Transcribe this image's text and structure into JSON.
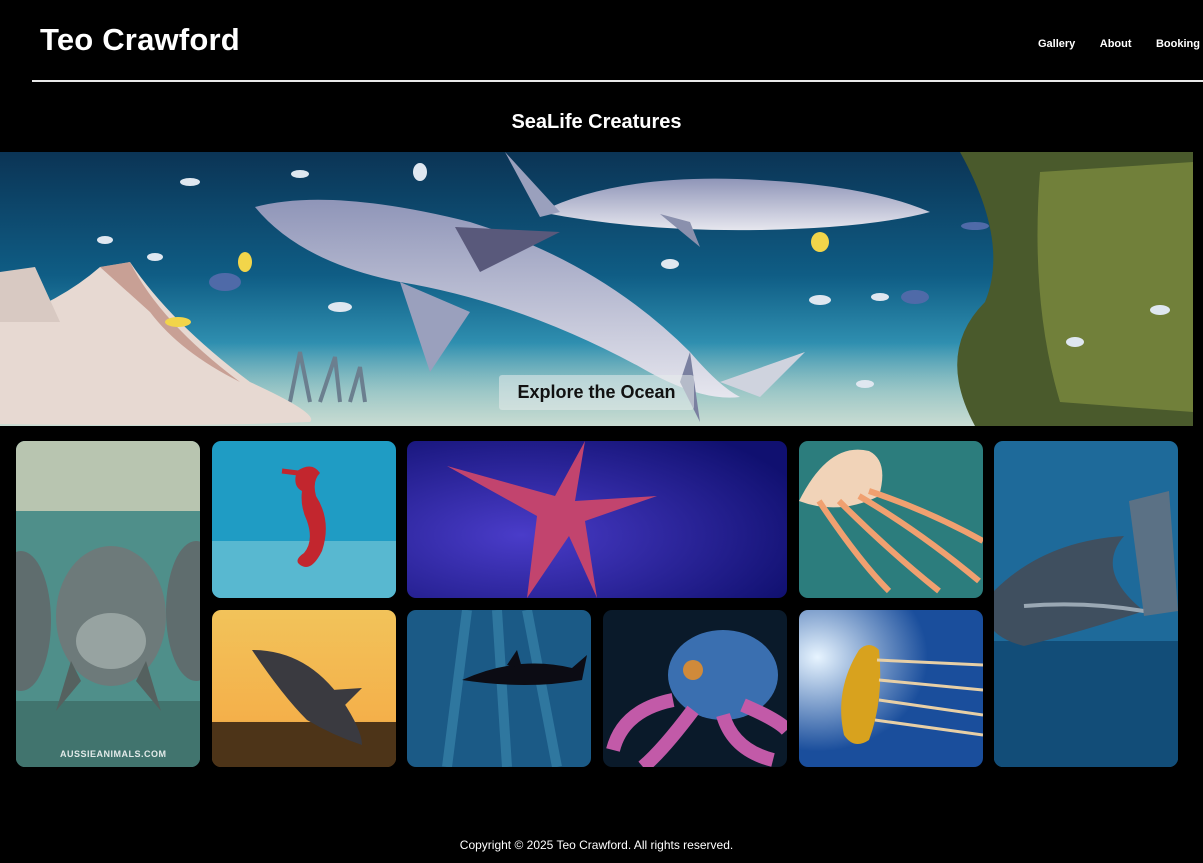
{
  "header": {
    "site_title": "Teo Crawford",
    "nav": [
      "Gallery",
      "About",
      "Booking"
    ]
  },
  "section": {
    "title": "SeaLife Creatures"
  },
  "hero": {
    "cta_label": "Explore the Ocean",
    "alt": "Sharks and ray swimming in an aquarium"
  },
  "gallery": [
    {
      "alt": "Manatees underwater",
      "watermark": "AUSSIEANIMALS.COM"
    },
    {
      "alt": "Red seahorse"
    },
    {
      "alt": "Pink starfish"
    },
    {
      "alt": "Orange jellyfish"
    },
    {
      "alt": "Whale feeding on fish"
    },
    {
      "alt": "Great white shark breaching at sunset"
    },
    {
      "alt": "Orca swimming in sunbeams"
    },
    {
      "alt": "Blue-ringed octopus"
    },
    {
      "alt": "Golden jellyfish"
    }
  ],
  "footer": {
    "text": "Copyright © 2025 Teo Crawford. All rights reserved."
  }
}
